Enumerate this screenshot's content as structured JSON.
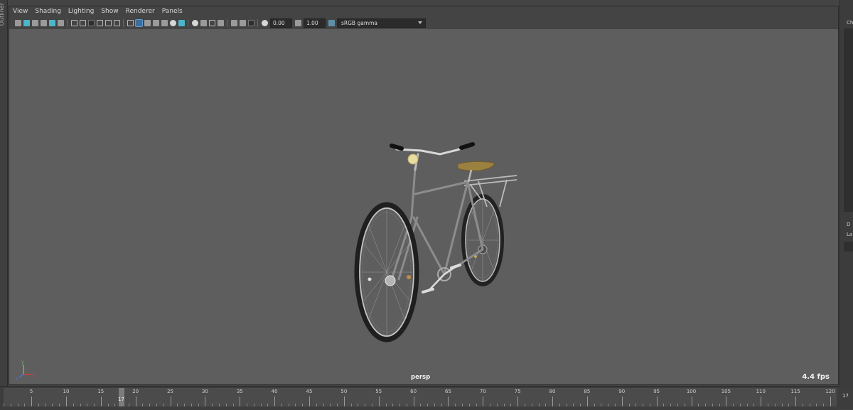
{
  "left_strip": {
    "label": "Outliner"
  },
  "menu": [
    "View",
    "Shading",
    "Lighting",
    "Show",
    "Renderer",
    "Panels"
  ],
  "toolbar": {
    "exposure_value": "0.00",
    "gamma_value": "1.00",
    "color_transform": "sRGB gamma"
  },
  "viewport": {
    "camera": "persp",
    "fps": "4.4 fps",
    "axis_labels": {
      "x": "x",
      "y": "y",
      "z": "z"
    }
  },
  "right_panel": {
    "label_top": "Ch",
    "label_mid": "D",
    "label_low": "La"
  },
  "timeline": {
    "ticks": [
      "5",
      "10",
      "15",
      "20",
      "25",
      "30",
      "35",
      "40",
      "45",
      "50",
      "55",
      "60",
      "65",
      "70",
      "75",
      "80",
      "85",
      "90",
      "95",
      "100",
      "105",
      "110",
      "115",
      "120"
    ],
    "current_frame": "17",
    "frame_field": "17"
  },
  "colors": {
    "viewport_bg": "#5e5e5e",
    "accent": "#4ab6c7",
    "seat": "#9b8140",
    "lamp": "#e8dca0"
  }
}
